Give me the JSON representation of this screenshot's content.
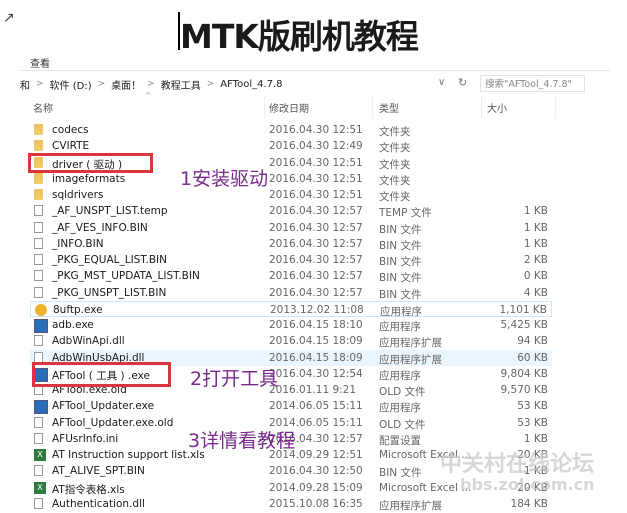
{
  "title": "MTK版刷机教程",
  "menu": {
    "view": "查看"
  },
  "breadcrumb": [
    "和",
    "软件 (D:)",
    "桌面！",
    "教程工具",
    "AFTool_4.7.8"
  ],
  "search": {
    "placeholder": "搜索\"AFTool_4.7.8\""
  },
  "columns": {
    "name": "名称",
    "date": "修改日期",
    "type": "类型",
    "size": "大小"
  },
  "files": [
    {
      "name": "codecs",
      "date": "2016.04.30 12:51",
      "type": "文件夹",
      "size": "",
      "icon": "folder"
    },
    {
      "name": "CVIRTE",
      "date": "2016.04.30 12:49",
      "type": "文件夹",
      "size": "",
      "icon": "folder"
    },
    {
      "name": "driver ( 驱动 )",
      "date": "2016.04.30 12:51",
      "type": "文件夹",
      "size": "",
      "icon": "folder"
    },
    {
      "name": "imageformats",
      "date": "2016.04.30 12:51",
      "type": "文件夹",
      "size": "",
      "icon": "folder"
    },
    {
      "name": "sqldrivers",
      "date": "2016.04.30 12:51",
      "type": "文件夹",
      "size": "",
      "icon": "folder"
    },
    {
      "name": "_AF_UNSPT_LIST.temp",
      "date": "2016.04.30 12:57",
      "type": "TEMP 文件",
      "size": "1 KB",
      "icon": "file"
    },
    {
      "name": "_AF_VES_INFO.BIN",
      "date": "2016.04.30 12:57",
      "type": "BIN 文件",
      "size": "1 KB",
      "icon": "file"
    },
    {
      "name": "_INFO.BIN",
      "date": "2016.04.30 12:57",
      "type": "BIN 文件",
      "size": "1 KB",
      "icon": "file"
    },
    {
      "name": "_PKG_EQUAL_LIST.BIN",
      "date": "2016.04.30 12:57",
      "type": "BIN 文件",
      "size": "2 KB",
      "icon": "file"
    },
    {
      "name": "_PKG_MST_UPDATA_LIST.BIN",
      "date": "2016.04.30 12:57",
      "type": "BIN 文件",
      "size": "0 KB",
      "icon": "file"
    },
    {
      "name": "_PKG_UNSPT_LIST.BIN",
      "date": "2016.04.30 12:57",
      "type": "BIN 文件",
      "size": "4 KB",
      "icon": "file"
    },
    {
      "name": "8uftp.exe",
      "date": "2013.12.02 11:08",
      "type": "应用程序",
      "size": "1,101 KB",
      "icon": "gear"
    },
    {
      "name": "adb.exe",
      "date": "2016.04.15 18:10",
      "type": "应用程序",
      "size": "5,425 KB",
      "icon": "exe"
    },
    {
      "name": "AdbWinApi.dll",
      "date": "2016.04.15 18:09",
      "type": "应用程序扩展",
      "size": "94 KB",
      "icon": "file"
    },
    {
      "name": "AdbWinUsbApi.dll",
      "date": "2016.04.15 18:09",
      "type": "应用程序扩展",
      "size": "60 KB",
      "icon": "file"
    },
    {
      "name": "AFTool ( 工具 ) .exe",
      "date": "2016.04.30 12:54",
      "type": "应用程序",
      "size": "9,804 KB",
      "icon": "exe"
    },
    {
      "name": "AFTool.exe.old",
      "date": "2016.01.11 9:21",
      "type": "OLD 文件",
      "size": "9,570 KB",
      "icon": "file"
    },
    {
      "name": "AFTool_Updater.exe",
      "date": "2014.06.05 15:11",
      "type": "应用程序",
      "size": "53 KB",
      "icon": "exe"
    },
    {
      "name": "AFTool_Updater.exe.old",
      "date": "2014.06.05 15:11",
      "type": "OLD 文件",
      "size": "53 KB",
      "icon": "file"
    },
    {
      "name": "AFUsrInfo.ini",
      "date": "2016.04.30 12:57",
      "type": "配置设置",
      "size": "1 KB",
      "icon": "file"
    },
    {
      "name": "AT Instruction support list.xls",
      "date": "2014.09.29 12:51",
      "type": "Microsoft Excel ...",
      "size": "20 KB",
      "icon": "xls"
    },
    {
      "name": "AT_ALIVE_SPT.BIN",
      "date": "2016.04.30 12:50",
      "type": "BIN 文件",
      "size": "1 KB",
      "icon": "file"
    },
    {
      "name": "AT指令表格.xls",
      "date": "2014.09.28 15:09",
      "type": "Microsoft Excel ...",
      "size": "20 KB",
      "icon": "xls"
    },
    {
      "name": "Authentication.dll",
      "date": "2015.10.08 16:35",
      "type": "应用程序扩展",
      "size": "184 KB",
      "icon": "file"
    }
  ],
  "annotations": {
    "step1": "1安装驱动",
    "step2": "2打开工具",
    "step3": "3详情看教程"
  },
  "watermark": {
    "line1": "中关村在线论坛",
    "line2": "bbs.zol.com.cn"
  }
}
